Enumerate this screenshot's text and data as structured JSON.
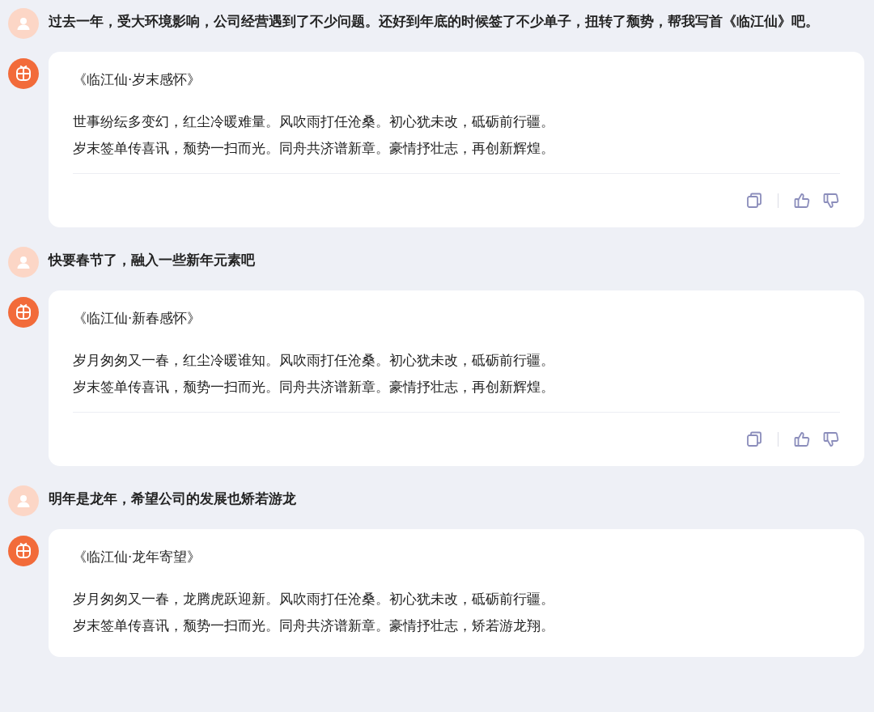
{
  "messages": [
    {
      "kind": "user",
      "text": "过去一年，受大环境影响，公司经营遇到了不少问题。还好到年底的时候签了不少单子，扭转了颓势，帮我写首《临江仙》吧。"
    },
    {
      "kind": "bot",
      "title": "《临江仙·岁末感怀》",
      "lines": [
        "世事纷纭多变幻，红尘冷暖难量。风吹雨打任沧桑。初心犹未改，砥砺前行疆。",
        "岁末签单传喜讯，颓势一扫而光。同舟共济谱新章。豪情抒壮志，再创新辉煌。"
      ],
      "footer": true
    },
    {
      "kind": "user",
      "text": "快要春节了，融入一些新年元素吧"
    },
    {
      "kind": "bot",
      "title": "《临江仙·新春感怀》",
      "lines": [
        "岁月匆匆又一春，红尘冷暖谁知。风吹雨打任沧桑。初心犹未改，砥砺前行疆。",
        "岁末签单传喜讯，颓势一扫而光。同舟共济谱新章。豪情抒壮志，再创新辉煌。"
      ],
      "footer": true
    },
    {
      "kind": "user",
      "text": "明年是龙年，希望公司的发展也矫若游龙"
    },
    {
      "kind": "bot",
      "title": "《临江仙·龙年寄望》",
      "lines": [
        "岁月匆匆又一春，龙腾虎跃迎新。风吹雨打任沧桑。初心犹未改，砥砺前行疆。",
        "岁末签单传喜讯，颓势一扫而光。同舟共济谱新章。豪情抒壮志，矫若游龙翔。"
      ],
      "footer": false
    }
  ]
}
